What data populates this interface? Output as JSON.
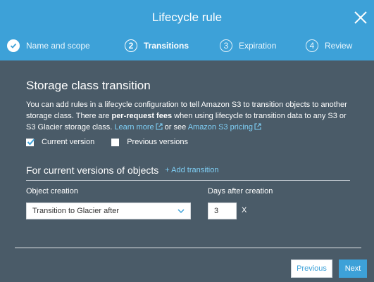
{
  "dialog": {
    "title": "Lifecycle rule",
    "close_icon": "close-icon"
  },
  "steps": [
    {
      "number": "1",
      "label": "Name and scope",
      "state": "done"
    },
    {
      "number": "2",
      "label": "Transitions",
      "state": "active"
    },
    {
      "number": "3",
      "label": "Expiration",
      "state": "pending"
    },
    {
      "number": "4",
      "label": "Review",
      "state": "pending"
    }
  ],
  "section": {
    "title": "Storage class transition",
    "desc_part1": "You can add rules in a lifecycle configuration to tell Amazon S3 to transition objects to another storage class. There are ",
    "desc_bold": "per-request fees",
    "desc_part2": " when using lifecycle to transition data to any S3 or S3 Glacier storage class. ",
    "learn_more": "Learn more",
    "or_see": " or see ",
    "pricing_link": "Amazon S3 pricing"
  },
  "versions": {
    "current": {
      "label": "Current version",
      "checked": true
    },
    "previous": {
      "label": "Previous versions",
      "checked": false
    }
  },
  "current_versions": {
    "title": "For current versions of objects",
    "add_transition": "+ Add transition",
    "object_creation_label": "Object creation",
    "object_creation_value": "Transition to Glacier after",
    "days_label": "Days after creation",
    "days_value": "3",
    "days_suffix": "X"
  },
  "footer": {
    "previous_label": "Previous",
    "next_label": "Next"
  },
  "colors": {
    "header": "#3da1d8",
    "body": "#4a5b68",
    "link": "#7fd0f7"
  }
}
